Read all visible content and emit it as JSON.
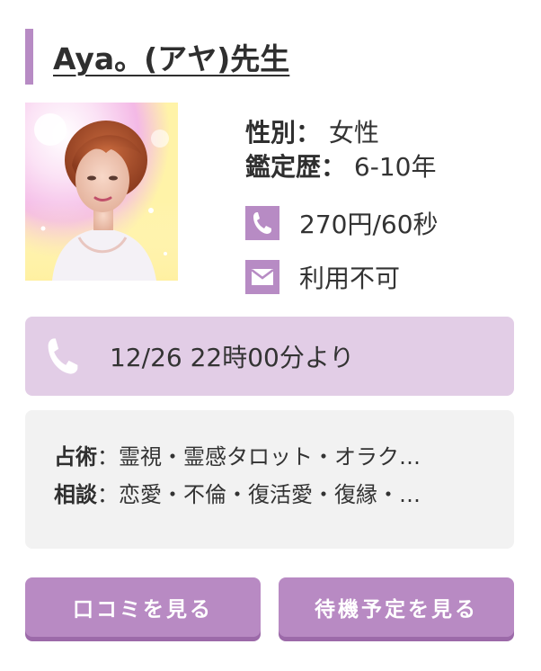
{
  "fortune_teller": {
    "name": "Aya。(アヤ)先生",
    "gender_label": "性別：",
    "gender_value": "女性",
    "experience_label": "鑑定歴：",
    "experience_value": "6-10年",
    "phone_price": "270円/60秒",
    "mail_status": "利用不可"
  },
  "icons": {
    "phone": "phone-icon",
    "mail": "mail-icon",
    "schedule_phone": "phone-icon"
  },
  "schedule": {
    "text": "12/26 22時00分より"
  },
  "details": {
    "fortune_label": "占術",
    "fortune_sep": "：",
    "fortune_value": "霊視・霊感タロット・オラク…",
    "consult_label": "相談",
    "consult_sep": "：",
    "consult_value": "恋愛・不倫・復活愛・復縁・…"
  },
  "buttons": {
    "reviews": "口コミを見る",
    "standby_schedule": "待機予定を見る"
  },
  "colors": {
    "accent": "#b78bc4",
    "schedule_bg": "#e2cde6",
    "details_bg": "#f2f2f2",
    "button_bg": "#b88ac3",
    "button_shadow": "#9c6aa9"
  }
}
